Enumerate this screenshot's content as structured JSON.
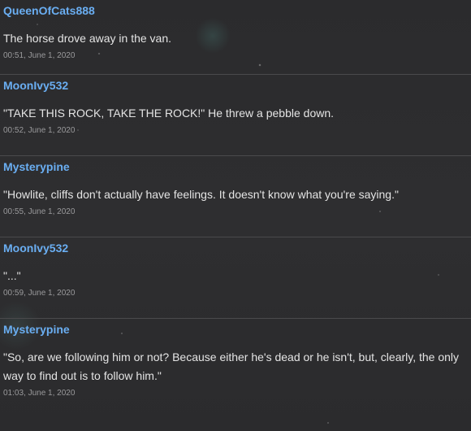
{
  "posts": [
    {
      "author": "QueenOfCats888",
      "body": "The horse drove away in the van.",
      "timestamp": "00:51, June 1, 2020"
    },
    {
      "author": "MoonIvy532",
      "body": "\"TAKE THIS ROCK, TAKE THE ROCK!\" He threw a pebble down.",
      "timestamp": "00:52, June 1, 2020"
    },
    {
      "author": "Mysterypine",
      "body": "\"Howlite, cliffs don't actually have feelings. It doesn't know what you're saying.\"",
      "timestamp": "00:55, June 1, 2020"
    },
    {
      "author": "MoonIvy532",
      "body": "\"...\"",
      "timestamp": "00:59, June 1, 2020"
    },
    {
      "author": "Mysterypine",
      "body": "\"So, are we following him or not? Because either he's dead or he isn't, but, clearly, the only way to find out is to follow him.\"",
      "timestamp": "01:03, June 1, 2020"
    }
  ]
}
